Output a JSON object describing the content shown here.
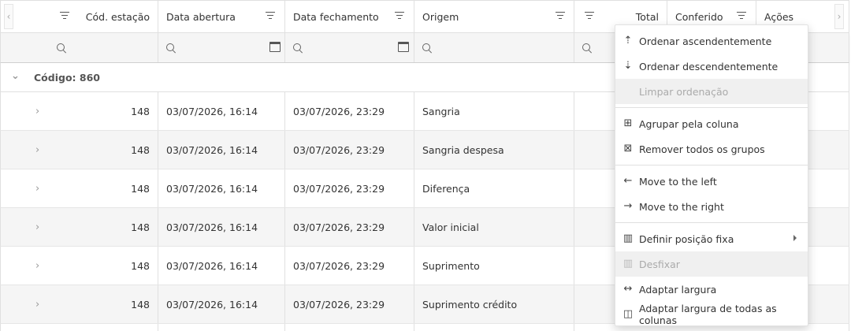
{
  "headers": {
    "cod_estacao": "Cód. estação",
    "data_abertura": "Data abertura",
    "data_fechamento": "Data fechamento",
    "origem": "Origem",
    "total": "Total",
    "conferido": "Conferido",
    "acoes": "Ações"
  },
  "group": {
    "label": "Código: 860"
  },
  "rows": [
    {
      "cod": "148",
      "abertura": "03/07/2026, 16:14",
      "fechamento": "03/07/2026, 23:29",
      "origem": "Sangria"
    },
    {
      "cod": "148",
      "abertura": "03/07/2026, 16:14",
      "fechamento": "03/07/2026, 23:29",
      "origem": "Sangria despesa"
    },
    {
      "cod": "148",
      "abertura": "03/07/2026, 16:14",
      "fechamento": "03/07/2026, 23:29",
      "origem": "Diferença"
    },
    {
      "cod": "148",
      "abertura": "03/07/2026, 16:14",
      "fechamento": "03/07/2026, 23:29",
      "origem": "Valor inicial"
    },
    {
      "cod": "148",
      "abertura": "03/07/2026, 16:14",
      "fechamento": "03/07/2026, 23:29",
      "origem": "Suprimento"
    },
    {
      "cod": "148",
      "abertura": "03/07/2026, 16:14",
      "fechamento": "03/07/2026, 23:29",
      "origem": "Suprimento crédito"
    }
  ],
  "menu": {
    "sort_asc": "Ordenar ascendentemente",
    "sort_desc": "Ordenar descendentemente",
    "clear_sort": "Limpar ordenação",
    "group_by": "Agrupar pela coluna",
    "remove_groups": "Remover todos os grupos",
    "move_left": "Move to the left",
    "move_right": "Move to the right",
    "fix_position": "Definir posição fixa",
    "unfix": "Desfixar",
    "fit_width": "Adaptar largura",
    "fit_all": "Adaptar largura de todas as colunas"
  },
  "icons": {
    "filter": "filter-icon",
    "search": "search-icon",
    "calendar": "calendar-icon",
    "expand": "chevron-right-icon",
    "collapse": "chevron-down-icon"
  }
}
